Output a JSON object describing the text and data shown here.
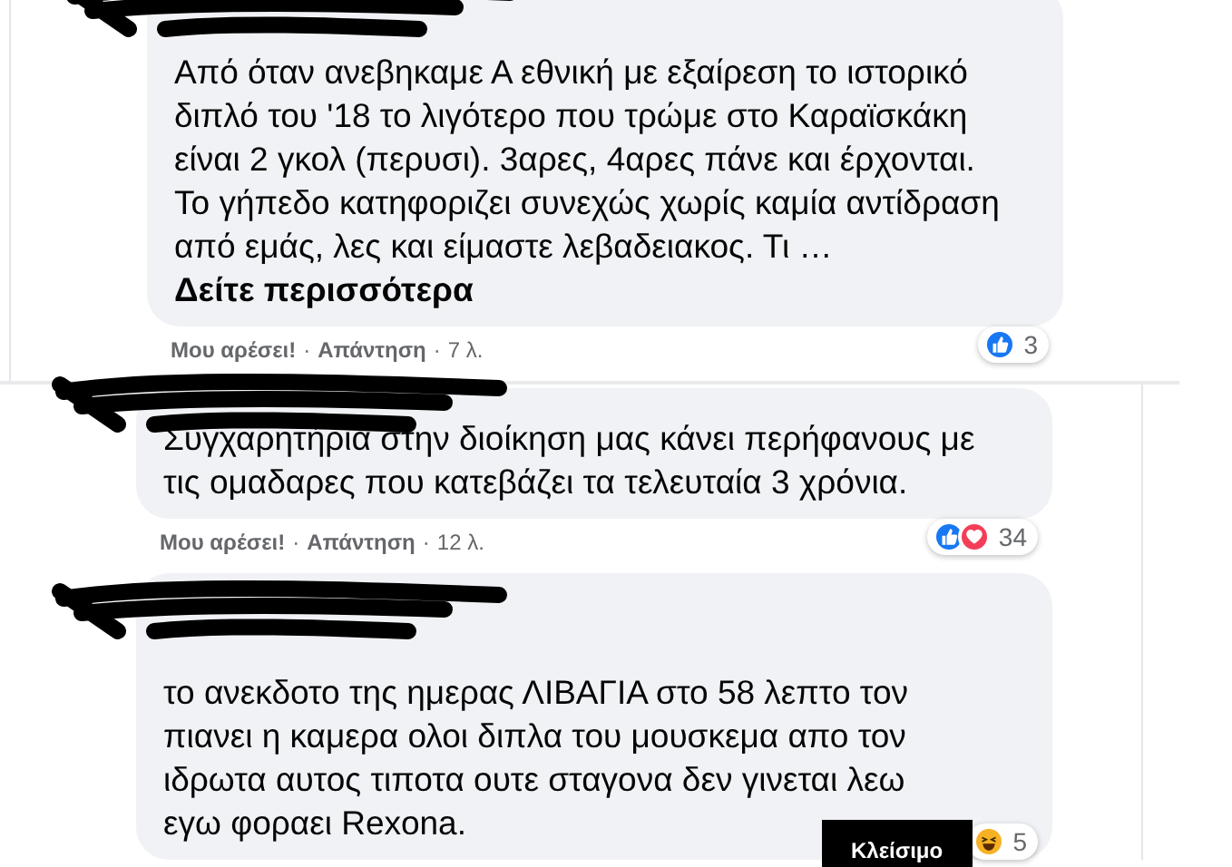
{
  "comments": [
    {
      "text": "Από όταν ανεβηκαμε Α εθνική με εξαίρεση το ιστορικό διπλό του '18 το λιγότερο που τρώμε στο Καραϊσκάκη είναι 2 γκολ (περυσι). 3αρες, 4αρες πάνε και έρχονται. Το γήπεδο κατηφοριζει συνεχώς χωρίς καμία αντίδραση από εμάς, λες και είμαστε λεβαδειακος. Τι …",
      "see_more": "Δείτε περισσότερα",
      "like": "Μου αρέσει!",
      "dot_1": "·",
      "reply": "Απάντηση",
      "dot_2": "·",
      "time": "7 λ.",
      "reactions": [
        {
          "kind": "like"
        }
      ],
      "reaction_count": "3"
    },
    {
      "text": "Συγχαρητήρια στην διοίκηση μας κάνει περήφανους με τις ομαδαρες που κατεβάζει τα τελευταία 3 χρόνια.",
      "like": "Μου αρέσει!",
      "dot_1": "·",
      "reply": "Απάντηση",
      "dot_2": "·",
      "time": "12 λ.",
      "reactions": [
        {
          "kind": "like"
        },
        {
          "kind": "love"
        }
      ],
      "reaction_count": "34"
    },
    {
      "text": "το ανεκδοτο της ημερας ΛΙΒΑΓΙΑ στο 58 λεπτο τον πιανει η καμερα ολοι διπλα του μουσκεμα απο τον ιδρωτα αυτος τιποτα ουτε σταγονα δεν γινεται λεω εγω φοραει Rexona.",
      "reactions": [
        {
          "kind": "haha"
        }
      ],
      "reaction_count": "5"
    }
  ],
  "tooltip": {
    "label": "Κλείσιμο"
  }
}
